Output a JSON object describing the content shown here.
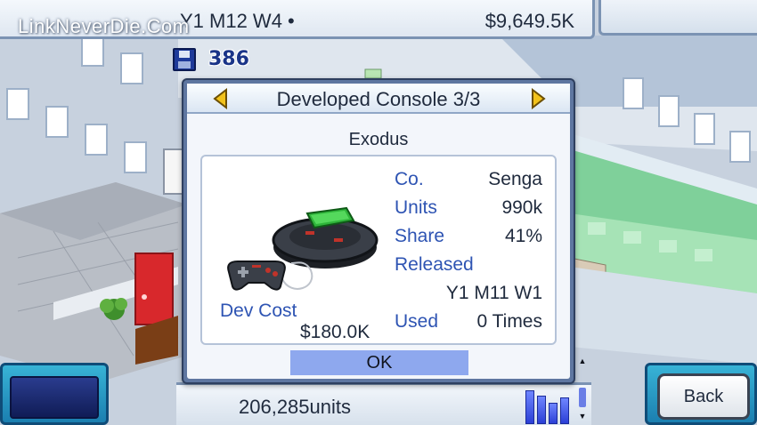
{
  "watermark": "LinkNeverDie.Com",
  "status": {
    "date": "Y1 M12 W4 •",
    "money": "$9,649.5K",
    "save_count": "386",
    "save_icon": "floppy-disk-icon"
  },
  "dialog": {
    "title": "Developed Console 3/3",
    "console_name": "Exodus",
    "stats": {
      "company_label": "Co.",
      "company_value": "Senga",
      "units_label": "Units",
      "units_value": "990k",
      "share_label": "Share",
      "share_value": "41%",
      "released_label": "Released",
      "released_value": "Y1 M11 W1",
      "used_label": "Used",
      "used_value": "0 Times"
    },
    "dev_cost_label": "Dev Cost",
    "dev_cost_value": "$180.0K",
    "ok_label": "OK",
    "icons": {
      "prev": "triangle-left-icon",
      "next": "triangle-right-icon",
      "console": "game-console-icon",
      "controller": "gamepad-icon"
    }
  },
  "bottom": {
    "units_text": "206,285units",
    "back_label": "Back",
    "sales_bars": [
      0.95,
      0.8,
      0.6,
      0.75
    ]
  },
  "colors": {
    "label_blue": "#2e54b3",
    "ok_blue": "#8ea8ee",
    "arrow_yellow": "#f2c21b"
  }
}
